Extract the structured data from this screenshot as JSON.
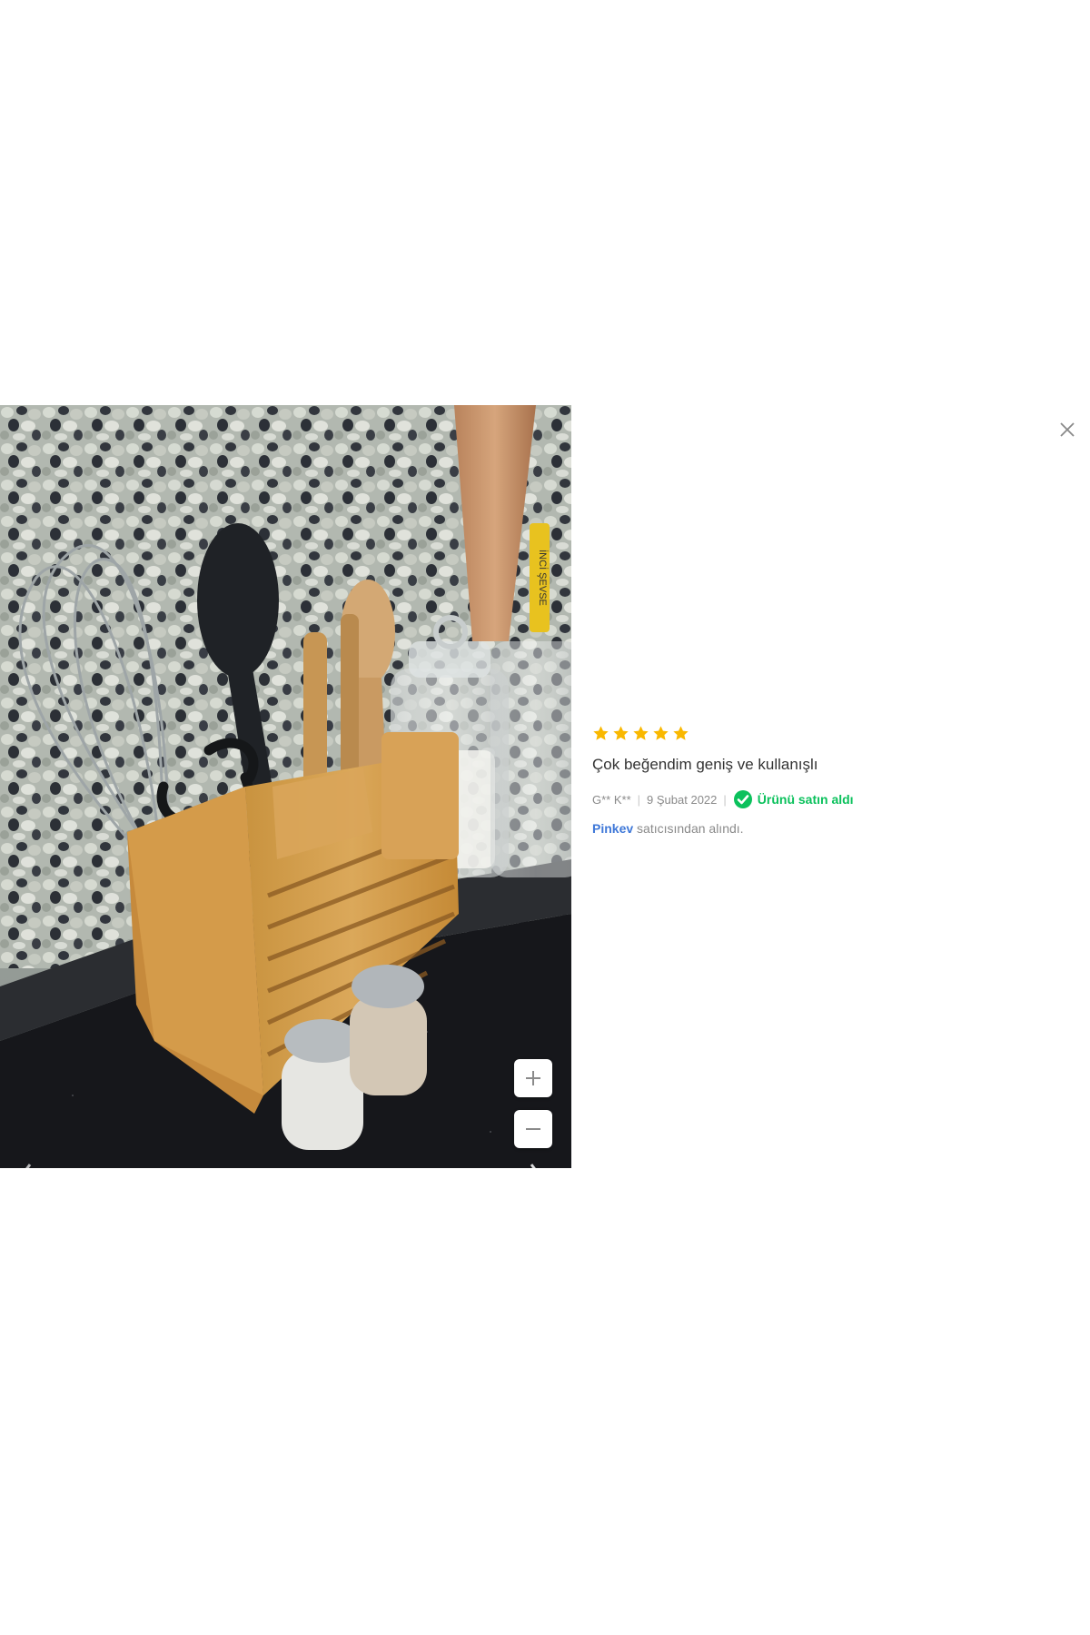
{
  "review": {
    "rating": 5,
    "max_rating": 5,
    "star_color": "#f9b800",
    "text": "Çok beğendim geniş ve kullanışlı",
    "author": "G** K**",
    "date": "9 Şubat 2022",
    "verified_label": "Ürünü satın aldı",
    "verified_color": "#0bc15c",
    "seller_name": "Pinkev",
    "seller_suffix": " satıcısından alındı."
  },
  "icons": {
    "close": "close-icon",
    "prev": "chevron-left-icon",
    "next": "chevron-right-icon",
    "zoom_in": "plus-icon",
    "zoom_out": "minus-icon",
    "verified": "check-circle-icon",
    "star": "star-icon"
  },
  "photo": {
    "jar_label": "İNCİ ŞEVSE"
  }
}
